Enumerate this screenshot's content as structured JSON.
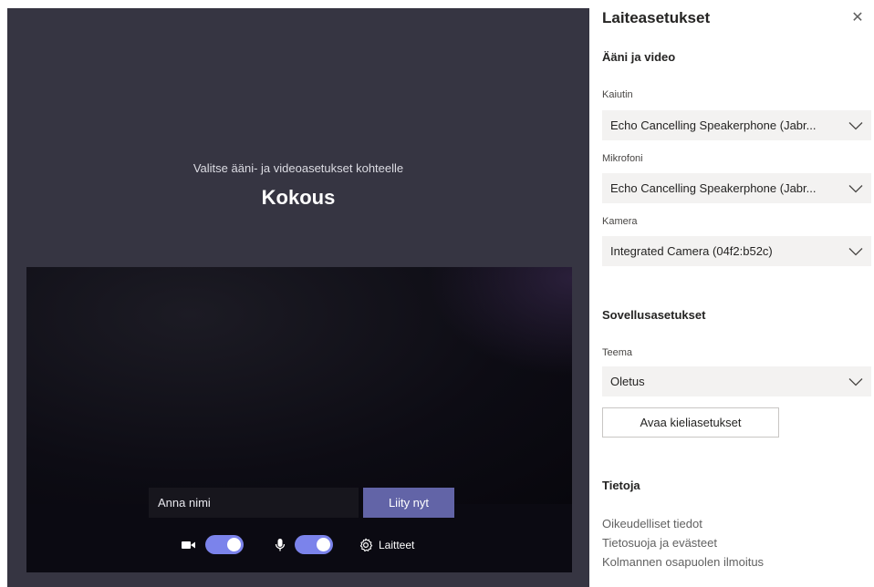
{
  "meeting": {
    "subtitle": "Valitse ääni- ja videoasetukset kohteelle",
    "title": "Kokous",
    "name_placeholder": "Anna nimi",
    "join_label": "Liity nyt",
    "camera_on": true,
    "mic_on": true,
    "devices_label": "Laitteet"
  },
  "settings": {
    "title": "Laiteasetukset",
    "close_icon": "close-icon",
    "audio_video_heading": "Ääni ja video",
    "speaker_label": "Kaiutin",
    "speaker_value": "Echo Cancelling Speakerphone (Jabr...",
    "mic_label": "Mikrofoni",
    "mic_value": "Echo Cancelling Speakerphone (Jabr...",
    "camera_label": "Kamera",
    "camera_value": "Integrated Camera (04f2:b52c)",
    "app_heading": "Sovellusasetukset",
    "theme_label": "Teema",
    "theme_value": "Oletus",
    "language_button": "Avaa kieliasetukset",
    "about_heading": "Tietoja",
    "links": [
      "Oikeudelliset tiedot",
      "Tietosuoja ja evästeet",
      "Kolmannen osapuolen ilmoitus"
    ]
  },
  "colors": {
    "accent": "#6264a7",
    "toggle": "#7b83eb",
    "stage_bg": "#363542"
  }
}
